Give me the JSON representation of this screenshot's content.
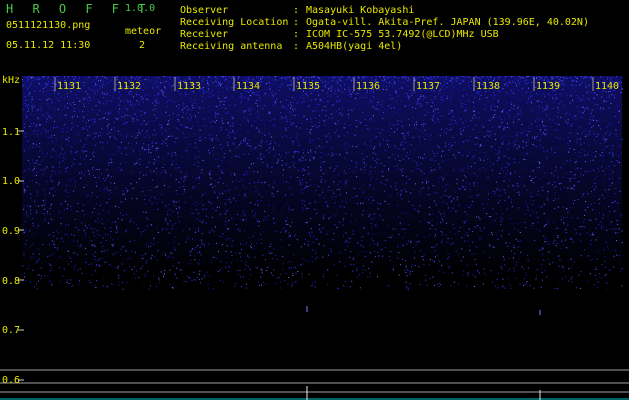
{
  "header": {
    "app_title": "H R O F F T",
    "version": "1.0.0",
    "file_name": "0511121130.png",
    "datetime": "05.11.12 11:30",
    "meteor_label": "meteor",
    "meteor_count": "2",
    "info": [
      {
        "label": "Observer",
        "sep": ":",
        "value": "Masayuki Kobayashi"
      },
      {
        "label": "Receiving Location",
        "sep": ":",
        "value": "Ogata-vill. Akita-Pref. JAPAN (139.96E, 40.02N)"
      },
      {
        "label": "Receiver",
        "sep": ":",
        "value": "ICOM IC-575 53.7492(@LCD)MHz USB"
      },
      {
        "label": "Receiving antenna",
        "sep": ":",
        "value": "A504HB(yagi 4el)"
      }
    ]
  },
  "spectrogram": {
    "y_unit": "kHz",
    "y_ticks": [
      "1.1",
      "1.0",
      "0.9",
      "0.8",
      "0.7",
      "0.6"
    ],
    "time_labels": [
      "1131",
      "1132",
      "1133",
      "1134",
      "1135",
      "1136",
      "1137",
      "1138",
      "1139",
      "1140"
    ],
    "colors": {
      "label": "#e8e800",
      "noise": "#2a2ad8",
      "grid": "#a0a0a0",
      "trace": "#00c8c8"
    }
  }
}
